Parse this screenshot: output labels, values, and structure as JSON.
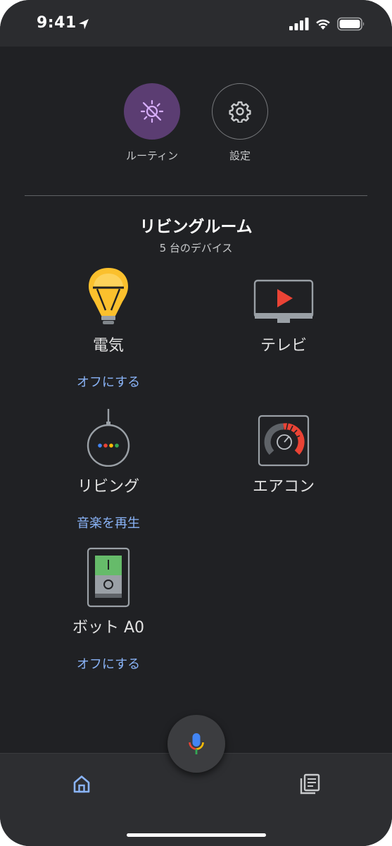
{
  "status_bar": {
    "time": "9:41"
  },
  "shortcuts": [
    {
      "label": "ルーティン",
      "icon": "routine-icon",
      "active": true
    },
    {
      "label": "設定",
      "icon": "gear-icon",
      "active": false
    }
  ],
  "room": {
    "title": "リビングルーム",
    "subtitle": "5 台のデバイス"
  },
  "devices": [
    {
      "name": "電気",
      "icon": "light-bulb-icon",
      "action": "オフにする"
    },
    {
      "name": "テレビ",
      "icon": "tv-icon",
      "action": ""
    },
    {
      "name": "リビング",
      "icon": "smart-speaker-icon",
      "action": "音楽を再生"
    },
    {
      "name": "エアコン",
      "icon": "thermostat-icon",
      "action": ""
    },
    {
      "name": "ボット A0",
      "icon": "switch-bot-icon",
      "action": "オフにする"
    }
  ],
  "bottom_nav": [
    {
      "icon": "home-icon",
      "active": true
    },
    {
      "icon": "feed-icon",
      "active": false
    }
  ],
  "colors": {
    "background": "#202124",
    "accent_link": "#8ab4f8",
    "routine_bg": "#5b3d72",
    "routine_icon": "#d7aefb"
  }
}
